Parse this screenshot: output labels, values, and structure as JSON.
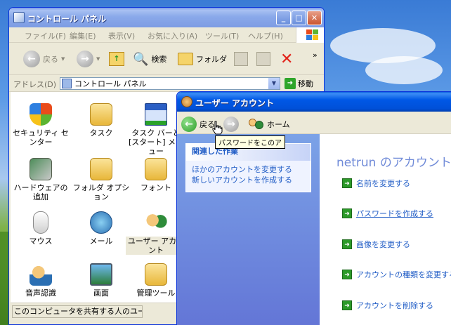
{
  "control_panel": {
    "title": "コントロール パネル",
    "menu": [
      "ファイル(F)",
      "編集(E)",
      "表示(V)",
      "お気に入り(A)",
      "ツール(T)",
      "ヘルプ(H)"
    ],
    "toolbar": {
      "back": "戻る",
      "search": "検索",
      "folders": "フォルダ"
    },
    "address": {
      "label": "アドレス(D)",
      "value": "コントロール パネル",
      "go": "移動"
    },
    "items": [
      {
        "label": "セキュリティ センター",
        "icon": "shield-icon"
      },
      {
        "label": "タスク",
        "icon": "tasks-folder-icon"
      },
      {
        "label": "タスク バーと [スタート] メニュー",
        "icon": "taskbar-icon"
      },
      {
        "label": "ハードウェアの追加",
        "icon": "hardware-icon"
      },
      {
        "label": "フォルダ オプション",
        "icon": "folder-options-icon"
      },
      {
        "label": "フォント",
        "icon": "fonts-folder-icon"
      },
      {
        "label": "マウス",
        "icon": "mouse-icon"
      },
      {
        "label": "メール",
        "icon": "mail-icon"
      },
      {
        "label": "ユーザー アカウント",
        "icon": "user-accounts-icon"
      },
      {
        "label": "音声認識",
        "icon": "speech-icon"
      },
      {
        "label": "画面",
        "icon": "display-icon"
      },
      {
        "label": "管理ツール",
        "icon": "admin-tools-icon"
      }
    ],
    "status": "このコンピュータを共有する人のユーザー"
  },
  "user_accounts": {
    "title": "ユーザー アカウント",
    "nav": {
      "back": "戻る",
      "home": "ホーム"
    },
    "task_pane": {
      "header": "関連した作業",
      "links": [
        "ほかのアカウントを変更する",
        "新しいアカウントを作成する"
      ]
    },
    "heading": "netrun のアカウント(",
    "actions": [
      "名前を変更する",
      "パスワードを作成する",
      "画像を変更する",
      "アカウントの種類を変更する",
      "アカウントを削除する"
    ],
    "tooltip": "パスワードをこのア"
  },
  "colors": {
    "title_active": "#0058e6",
    "link": "#215dc6",
    "task_pane": "#6375d6",
    "green_arrow": "#2c9a29"
  }
}
